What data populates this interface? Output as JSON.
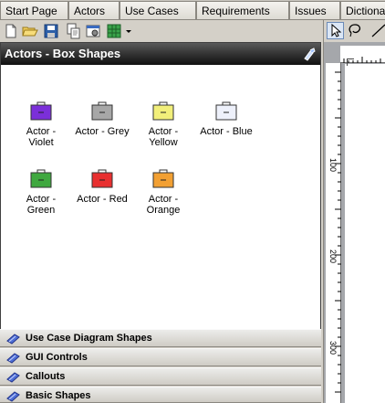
{
  "tabs": [
    {
      "label": "Start Page"
    },
    {
      "label": "Actors"
    },
    {
      "label": "Use Cases"
    },
    {
      "label": "Requirements"
    },
    {
      "label": "Issues"
    },
    {
      "label": "Dictiona"
    }
  ],
  "toolbar": {
    "icons": [
      "new-document-icon",
      "open-folder-icon",
      "save-icon",
      "copy-document-icon",
      "properties-icon",
      "grid-icon",
      "dropdown-arrow-icon"
    ]
  },
  "shapes_panel": {
    "title": "Actors - Box Shapes",
    "items": [
      {
        "label": "Actor -\nViolet",
        "color": "#7b2fd9"
      },
      {
        "label": "Actor - Grey",
        "color": "#a7a7a7"
      },
      {
        "label": "Actor -\nYellow",
        "color": "#f2ef7a"
      },
      {
        "label": "Actor - Blue",
        "color": "#eef1fb"
      },
      {
        "label": "Actor -\nGreen",
        "color": "#3fa83f"
      },
      {
        "label": "Actor - Red",
        "color": "#e83030"
      },
      {
        "label": "Actor -\nOrange",
        "color": "#f2a033"
      }
    ]
  },
  "categories": [
    {
      "label": "Use Case Diagram Shapes"
    },
    {
      "label": "GUI Controls"
    },
    {
      "label": "Callouts"
    },
    {
      "label": "Basic Shapes"
    }
  ],
  "ruler": {
    "marks": [
      "100",
      "200",
      "300"
    ]
  },
  "colors": {
    "header_bg": "#2f2f2f",
    "canvas_bg": "#a5a7ab",
    "panel_bg": "#d4d0c8"
  }
}
